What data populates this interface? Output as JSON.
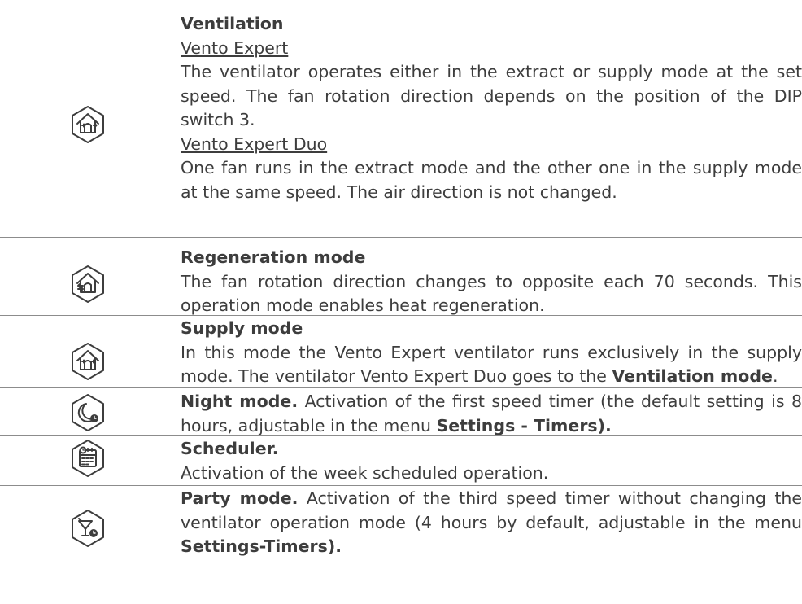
{
  "modes": [
    {
      "icon": "house-ventilation-icon",
      "title": "Ventilation",
      "sections": [
        {
          "subtitle": "Vento Expert",
          "text": "The ventilator operates either in the extract or supply mode at the set speed. The fan rotation direction depends on the position of the DIP switch 3."
        },
        {
          "subtitle": "Vento Expert Duo",
          "text": "One fan runs in the extract mode and the other one in the supply mode at the same speed. The air direction is not changed."
        }
      ]
    },
    {
      "icon": "house-regeneration-icon",
      "title": "Regeneration mode",
      "text": "The fan rotation direction changes to opposite each 70 seconds. This operation mode enables heat regeneration."
    },
    {
      "icon": "house-supply-icon",
      "title": "Supply mode",
      "text_before": "In this mode the Vento Expert ventilator runs exclusively in the supply mode. The ventilator Vento Expert Duo goes to the ",
      "text_bold": "Ventilation mode",
      "text_after": "."
    },
    {
      "icon": "moon-clock-icon",
      "title": "Night mode.",
      "text_before": " Activation of the first speed timer (the default setting is 8 hours, adjustable in the menu ",
      "text_bold": "Settings - Timers)."
    },
    {
      "icon": "calendar-clock-icon",
      "title": "Scheduler.",
      "text": "Activation of the week scheduled operation."
    },
    {
      "icon": "cocktail-clock-icon",
      "title": "Party mode.",
      "text_before": " Activation of the third speed timer without changing the ventilator operation mode (4 hours by default, adjustable in the menu ",
      "text_bold": "Settings-Timers)."
    }
  ]
}
